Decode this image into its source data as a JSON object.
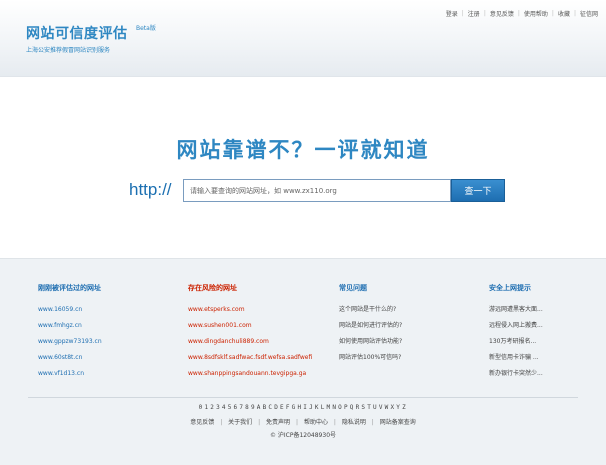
{
  "logo": {
    "title": "网站可信度评估",
    "beta": "Beta版",
    "subtitle": "上海公安推荐假冒网站识别服务"
  },
  "topnav": [
    "登录",
    "注册",
    "意见反馈",
    "使用帮助",
    "收藏",
    "征信网"
  ],
  "main": {
    "slogan": "网站靠谱不？一评就知道",
    "prefix": "http://",
    "search_placeholder": "请输入要查询的网站网址，如 www.zx110.org",
    "search_button": "查一下"
  },
  "columns": [
    {
      "title": "刚刚被评估过的网址",
      "items": [
        "www.16059.cn",
        "www.fmhgz.cn",
        "www.gppzw73193.cn",
        "www.60st8t.cn",
        "www.vf1d13.cn"
      ]
    },
    {
      "title": "存在风险的网址",
      "items": [
        "www.etsperks.com",
        "www.sushen001.com",
        "www.dingdanchuli889.com",
        "www.8sdfsklf.sadfwac.fsdf.wefsa.sadfwefi",
        "www.shanppingsandouann.tevgipga.ga"
      ]
    },
    {
      "title": "常见问题",
      "items": [
        "这个网站是干什么的?",
        "网站是如何进行评估的?",
        "如何使用网站评估功能?",
        "网站评估100%可信吗?"
      ]
    },
    {
      "title": "安全上网提示",
      "items": [
        "游远网遭黑客大面...",
        "远程侵入网上搬费...",
        "130万考研报名...",
        "新型信用卡诈骗 ...",
        "新办银行卡突然少..."
      ]
    }
  ],
  "alphabet": [
    "0",
    "1",
    "2",
    "3",
    "4",
    "5",
    "6",
    "7",
    "8",
    "9",
    "A",
    "B",
    "C",
    "D",
    "E",
    "F",
    "G",
    "H",
    "I",
    "J",
    "K",
    "L",
    "M",
    "N",
    "O",
    "P",
    "Q",
    "R",
    "S",
    "T",
    "U",
    "V",
    "W",
    "X",
    "Y",
    "Z"
  ],
  "footer_links": [
    "意见反馈",
    "关于我们",
    "免责声明",
    "帮助中心",
    "隐私说明",
    "网站备案查询"
  ],
  "icp": "© 沪ICP备12048930号",
  "colors": {
    "brand_blue": "#2e87c2",
    "button_blue": "#1e6eb1",
    "risk_red": "#cc2200",
    "footer_bg": "#eef2f5"
  }
}
